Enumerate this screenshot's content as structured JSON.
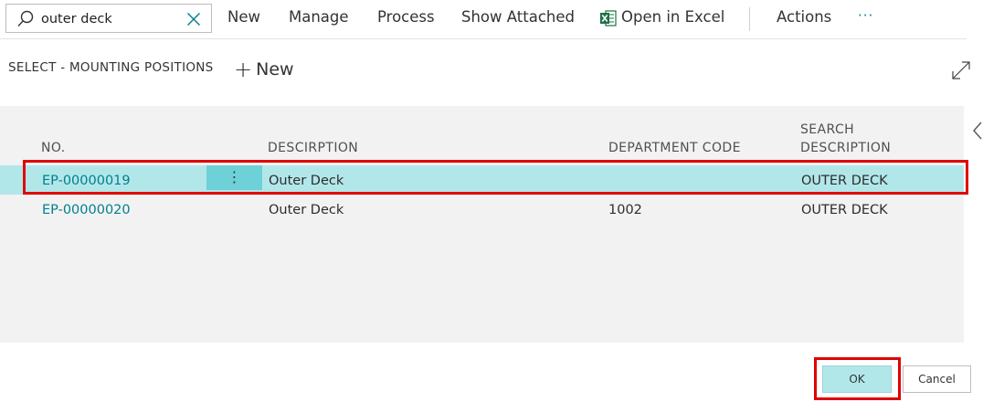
{
  "search": {
    "value": "outer deck"
  },
  "toolbar": {
    "new": "New",
    "manage": "Manage",
    "process": "Process",
    "show_attached": "Show Attached",
    "open_in_excel": "Open in Excel",
    "actions": "Actions",
    "more": "···"
  },
  "page": {
    "title": "SELECT - MOUNTING POSITIONS",
    "new_action": "New"
  },
  "table": {
    "headers": {
      "no": "NO.",
      "description": "DESCIRPTION",
      "department_code": "DEPARTMENT CODE",
      "search_description_line1": "SEARCH",
      "search_description_line2": "DESCRIPTION"
    },
    "rows": [
      {
        "no": "EP-00000019",
        "description": "Outer Deck",
        "department_code": "",
        "search_description": "OUTER DECK",
        "selected": true
      },
      {
        "no": "EP-00000020",
        "description": "Outer Deck",
        "department_code": "1002",
        "search_description": "OUTER DECK",
        "selected": false
      }
    ]
  },
  "buttons": {
    "ok": "OK",
    "cancel": "Cancel"
  },
  "colors": {
    "accent_link": "#007f8e",
    "selected_row": "#b2e7ea",
    "row_action_button": "#6dd1d7",
    "excel_icon": "#1d7145",
    "highlight_border": "#e00000"
  }
}
